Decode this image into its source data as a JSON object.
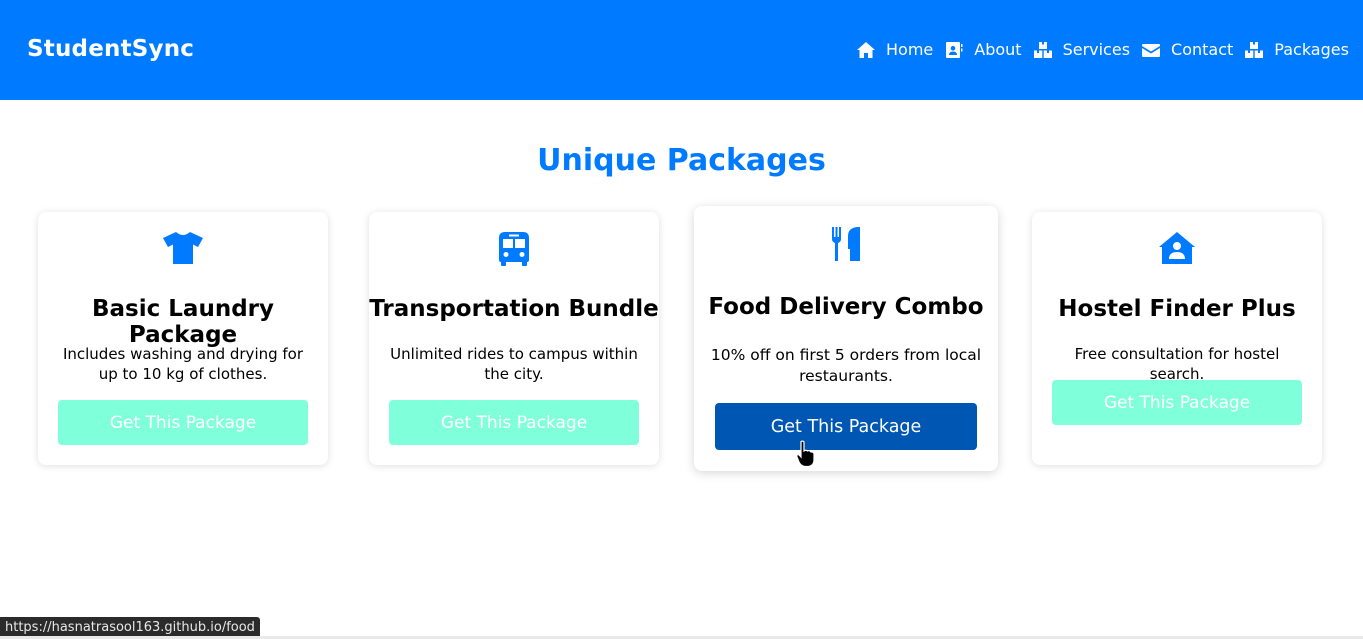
{
  "brand": "StudentSync",
  "nav": [
    {
      "label": "Home",
      "icon": "home-icon"
    },
    {
      "label": "About",
      "icon": "address-card-icon"
    },
    {
      "label": "Services",
      "icon": "boxes-icon"
    },
    {
      "label": "Contact",
      "icon": "envelope-icon"
    },
    {
      "label": "Packages",
      "icon": "boxes-icon"
    }
  ],
  "heading": "Unique Packages",
  "cards": [
    {
      "icon": "tshirt-icon",
      "title": "Basic Laundry Package",
      "desc": "Includes washing and drying for up to 10 kg of clothes.",
      "button": "Get This Package"
    },
    {
      "icon": "bus-icon",
      "title": "Transportation Bundle",
      "desc": "Unlimited rides to campus within the city.",
      "button": "Get This Package"
    },
    {
      "icon": "utensils-icon",
      "title": "Food Delivery Combo",
      "desc": "10% off on first 5 orders from local restaurants.",
      "button": "Get This Package"
    },
    {
      "icon": "house-user-icon",
      "title": "Hostel Finder Plus",
      "desc": "Free consultation for hostel search.",
      "button": "Get This Package"
    }
  ],
  "status_url": "https://hasnatrasool163.github.io/food",
  "colors": {
    "primary": "#007bff",
    "button_light": "#80ffdb",
    "button_hover": "#0056b3"
  }
}
